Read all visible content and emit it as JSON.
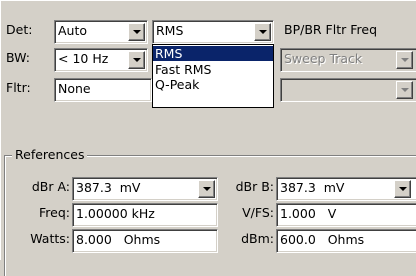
{
  "labels": {
    "det": "Det:",
    "bw": "BW:",
    "fltr": "Fltr:",
    "bp_br_fltr_freq": "BP/BR Fltr Freq",
    "references": "References",
    "dbr_a": "dBr A:",
    "dbr_b": "dBr B:",
    "freq": "Freq:",
    "vfs": "V/FS:",
    "watts": "Watts:",
    "dbm": "dBm:"
  },
  "fields": {
    "det_value": "Auto",
    "detector_value": "RMS",
    "bw_value": "< 10 Hz",
    "fltr_value": "None",
    "sweep_track_value": "Sweep Track",
    "dbr_a_value": "387.3  mV",
    "dbr_b_value": "387.3  mV",
    "freq_value": "1.00000 kHz",
    "vfs_value": "1.000   V",
    "watts_value": "8.000   Ohms",
    "dbm_value": "600.0   Ohms"
  },
  "detector_options": [
    "RMS",
    "Fast RMS",
    "Q-Peak"
  ],
  "detector_selected_index": 0,
  "colors": {
    "face": "#d4d0c8",
    "highlight": "#0a246a",
    "disabled_text": "#808080"
  }
}
